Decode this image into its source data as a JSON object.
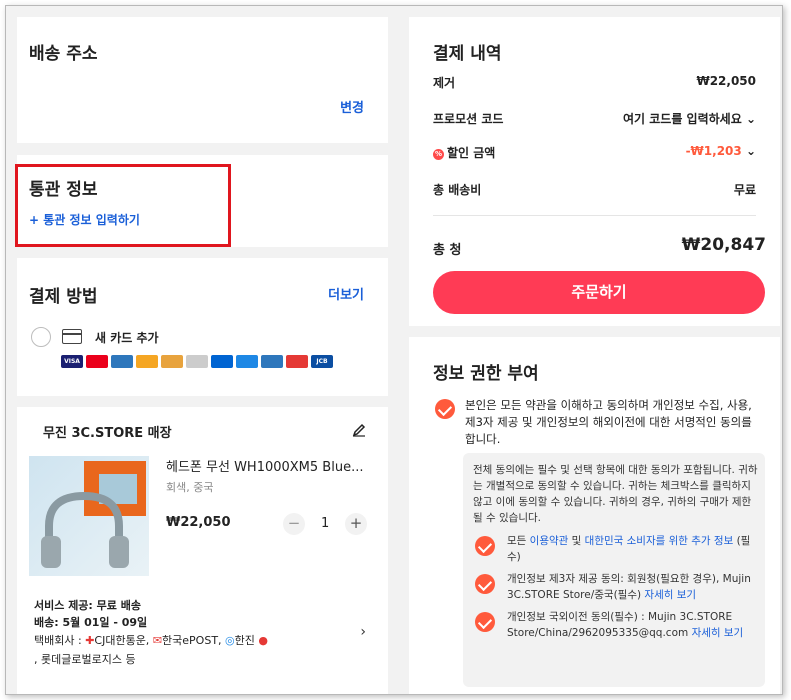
{
  "address": {
    "title": "배송 주소",
    "change": "변경"
  },
  "customs": {
    "title": "통관 정보",
    "add": "+ 통관 정보 입력하기"
  },
  "payment_method": {
    "title": "결제 방법",
    "more": "더보기",
    "new_card": "새 카드 추가",
    "brands": [
      {
        "name": "VISA",
        "color": "#1a1f71"
      },
      {
        "name": "MC",
        "color": "#eb001b"
      },
      {
        "name": "AMEX",
        "color": "#2e77bc"
      },
      {
        "name": "",
        "color": "#f5a623"
      },
      {
        "name": "",
        "color": "#e8a33d"
      },
      {
        "name": "",
        "color": "#cccccc"
      },
      {
        "name": "",
        "color": "#0064d2"
      },
      {
        "name": "",
        "color": "#1e88e5"
      },
      {
        "name": "AMEX",
        "color": "#2e77bc"
      },
      {
        "name": "",
        "color": "#e53935"
      },
      {
        "name": "JCB",
        "color": "#0b4ea2"
      }
    ]
  },
  "store": {
    "name": "무진 3C.STORE 매장",
    "product_name": "헤드폰 무선 WH1000XM5 Blue...",
    "option": "회색, 중국",
    "price": "₩22,050",
    "quantity": "1",
    "service": "서비스 제공: 무료 배송",
    "delivery": "배송: 5월 01일 - 09일",
    "carriers_label": "택배회사 :",
    "carriers": [
      "CJ대한통운,",
      "한국ePOST,",
      "한진",
      ", 롯데글로벌로지스",
      "등"
    ]
  },
  "summary": {
    "title": "결제 내역",
    "items_label": "제거",
    "items_value": "₩22,050",
    "promo_label": "프로모션 코드",
    "promo_value": "여기 코드를 입력하세요",
    "discount_label": "할인 금액",
    "discount_value": "-₩1,203",
    "shipping_label": "총 배송비",
    "shipping_value": "무료",
    "total_label": "총 청",
    "total_value": "₩20,847",
    "order_button": "주문하기"
  },
  "consent": {
    "title": "정보 권한 부여",
    "main": "본인은 모든 약관을 이해하고 동의하며 개인정보 수집, 사용, 제3자 제공 및 개인정보의 해외이전에 대한 서명적인 동의를 합니다.",
    "desc": "전체 동의에는 필수 및 선택 항목에 대한 동의가 포함됩니다. 귀하는 개별적으로 동의할 수 있습니다. 귀하는 체크박스를 클릭하지 않고 이에 동의할 수 있습니다. 귀하의 경우, 귀하의 구매가 제한될 수 있습니다.",
    "item1_pre": "모든 ",
    "item1_link1": "이용약관",
    "item1_mid": " 및 ",
    "item1_link2": "대한민국 소비자를 위한 추가 정보",
    "item1_post": " (필수)",
    "item2_text": "개인정보 제3자 제공 동의: 회원청(필요한 경우), Mujin 3C.STORE Store/중국(필수) ",
    "item2_link": "자세히 보기",
    "item3_text": "개인정보 국외이전 동의(필수) : Mujin 3C.STORE Store/China/2962095335@qq.com ",
    "item3_link": "자세히 보기"
  }
}
